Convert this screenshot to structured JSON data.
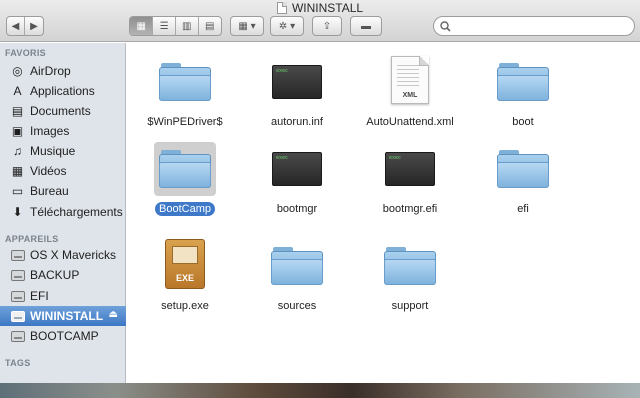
{
  "window": {
    "title": "WININSTALL"
  },
  "toolbar": {
    "back_glyph": "◀",
    "forward_glyph": "▶",
    "view_icons": [
      "▦",
      "☰",
      "▥",
      "▤"
    ],
    "arrange_glyph": "▦ ▾",
    "action_glyph": "✲ ▾",
    "share_glyph": "⇪",
    "label_glyph": "▬"
  },
  "search": {
    "value": "",
    "placeholder": ""
  },
  "sidebar": {
    "favorites_title": "FAVORIS",
    "favorites": [
      {
        "label": "AirDrop",
        "icon": "airdrop-icon",
        "glyph": "◎"
      },
      {
        "label": "Applications",
        "icon": "applications-icon",
        "glyph": "A"
      },
      {
        "label": "Documents",
        "icon": "documents-icon",
        "glyph": "▤"
      },
      {
        "label": "Images",
        "icon": "images-icon",
        "glyph": "▣"
      },
      {
        "label": "Musique",
        "icon": "music-icon",
        "glyph": "♫"
      },
      {
        "label": "Vidéos",
        "icon": "videos-icon",
        "glyph": "▦"
      },
      {
        "label": "Bureau",
        "icon": "desktop-icon",
        "glyph": "▭"
      },
      {
        "label": "Téléchargements",
        "icon": "downloads-icon",
        "glyph": "⬇"
      }
    ],
    "devices_title": "APPAREILS",
    "devices": [
      {
        "label": "OS X Mavericks",
        "selected": false
      },
      {
        "label": "BACKUP",
        "selected": false
      },
      {
        "label": "EFI",
        "selected": false
      },
      {
        "label": "WININSTALL",
        "selected": true
      },
      {
        "label": "BOOTCAMP",
        "selected": false
      }
    ],
    "eject_glyph": "⏏",
    "tags_title": "TAGS"
  },
  "files": [
    {
      "name": "$WinPEDriver$",
      "kind": "folder"
    },
    {
      "name": "autorun.inf",
      "kind": "exec"
    },
    {
      "name": "AutoUnattend.xml",
      "kind": "xml"
    },
    {
      "name": "boot",
      "kind": "folder"
    },
    {
      "name": "BootCamp",
      "kind": "folder",
      "selected": true
    },
    {
      "name": "bootmgr",
      "kind": "exec"
    },
    {
      "name": "bootmgr.efi",
      "kind": "exec"
    },
    {
      "name": "efi",
      "kind": "folder"
    },
    {
      "name": "setup.exe",
      "kind": "exe"
    },
    {
      "name": "sources",
      "kind": "folder"
    },
    {
      "name": "support",
      "kind": "folder"
    }
  ],
  "icon_texts": {
    "exec": "exec",
    "xml": "XML",
    "exe": "EXE"
  },
  "colors": {
    "selection": "#3d79c8",
    "sidebar_bg": "#dfe4ea",
    "folder": "#8bbde6"
  }
}
